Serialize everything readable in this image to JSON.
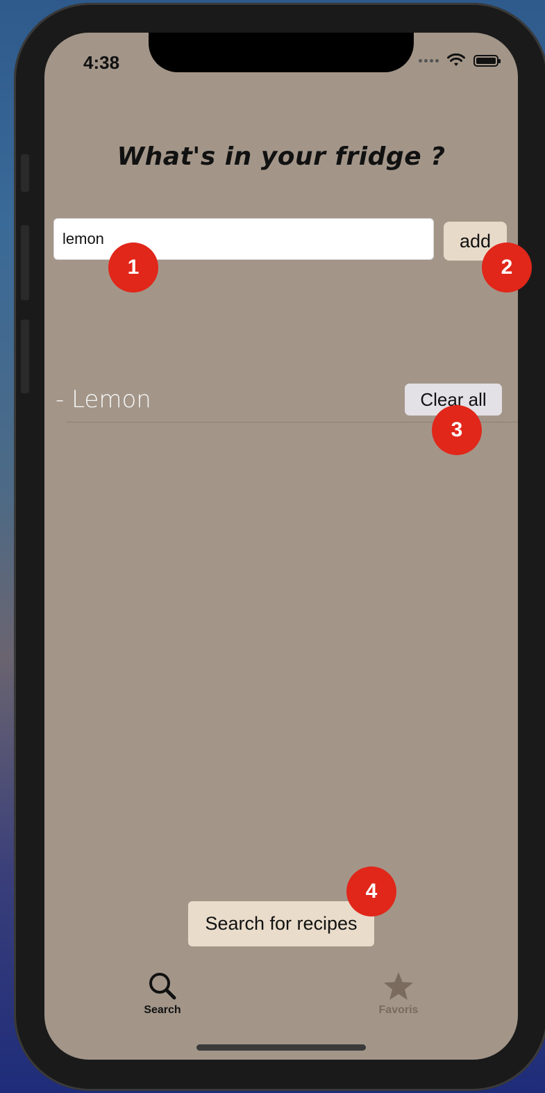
{
  "status_bar": {
    "time": "4:38"
  },
  "header": {
    "title": "What's in your fridge ?"
  },
  "ingredient_input": {
    "value": "lemon"
  },
  "add_button": {
    "label": "add"
  },
  "ingredients": [
    {
      "text": "- Lemon"
    }
  ],
  "clear_button": {
    "label": "Clear all"
  },
  "search_button": {
    "label": "Search for recipes"
  },
  "tab_bar": {
    "items": [
      {
        "label": "Search",
        "icon": "search-icon",
        "active": true
      },
      {
        "label": "Favoris",
        "icon": "star-icon",
        "active": false
      }
    ]
  },
  "annotations": [
    "1",
    "2",
    "3",
    "4"
  ],
  "colors": {
    "screen_bg": "#a39689",
    "button_bg": "#e8dac9",
    "clear_bg": "#e3e0e6",
    "badge": "#e0271a",
    "favoris_tint": "#7a6b5e"
  }
}
